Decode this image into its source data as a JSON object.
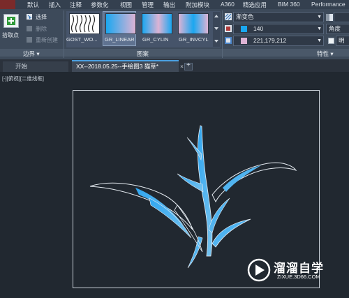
{
  "menu": [
    "默认",
    "插入",
    "注释",
    "参数化",
    "视图",
    "管理",
    "输出",
    "附加模块",
    "A360",
    "精选应用",
    "BIM 360",
    "Performance"
  ],
  "ribbon": {
    "boundary": {
      "pick_points_label": "拾取点",
      "select_label": "选择",
      "delete_label": "删除",
      "recreate_label": "重新创建",
      "panel_title": "边界 ▾"
    },
    "pattern": {
      "swatches": [
        "GOST_WO...",
        "GR_LINEAR",
        "GR_CYLIN",
        "GR_INVCYL"
      ],
      "panel_title": "图案"
    },
    "properties": {
      "type_value": "渐变色",
      "color1_value": "140",
      "color2_value": "221,179,212",
      "angle_label": "角度",
      "bright_label": "明",
      "panel_title": "特性 ▾"
    },
    "colors": {
      "color1": "#1aa7f0",
      "color2": "#ddb3d4",
      "accent": "#4a9fe0"
    }
  },
  "tabs": {
    "start": "开始",
    "active": "XX--2018.05.25--手绘图3  猫草*",
    "close": "×",
    "add": "+"
  },
  "viewport": {
    "label": "[-][俯视][二维线框]"
  },
  "watermark": {
    "title": "溜溜自学",
    "url": "ZIXUE.3D66.COM"
  }
}
